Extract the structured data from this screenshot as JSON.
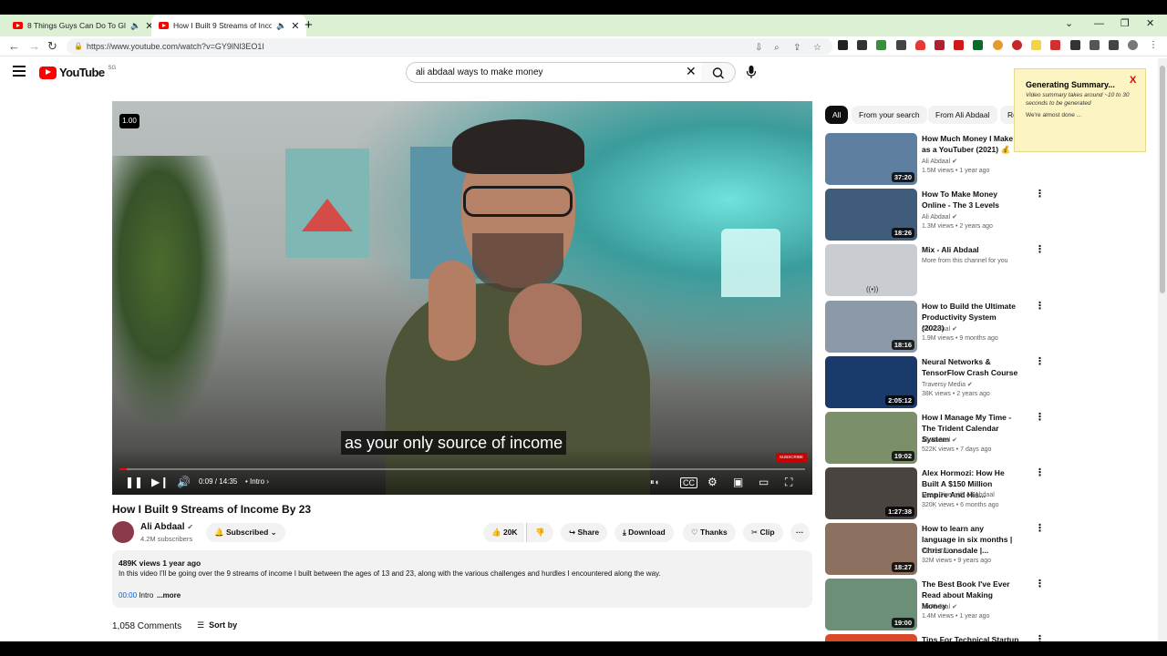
{
  "browser": {
    "tabs": [
      {
        "title": "8 Things Guys Can Do To Gl"
      },
      {
        "title": "How I Built 9 Streams of Inco"
      }
    ],
    "url": "https://www.youtube.com/watch?v=GY9lNl3EO1I"
  },
  "header": {
    "logo_text": "YouTube",
    "country_code": "SG",
    "search_value": "ali abdaal ways to make money"
  },
  "player": {
    "speed": "1.00",
    "caption": "as your only source of income",
    "time": "0:09 / 14:35",
    "chapter": "Intro",
    "progress_fraction": 0.011
  },
  "video": {
    "title": "How I Built 9 Streams of Income By 23",
    "channel": "Ali Abdaal",
    "subscribers": "4.2M subscribers",
    "subscribed_label": "Subscribed",
    "likes": "20K",
    "share_label": "Share",
    "download_label": "Download",
    "thanks_label": "Thanks",
    "clip_label": "Clip",
    "views_date": "489K views  1 year ago",
    "description": "In this video I'll be going over the 9 streams of income I built between the ages of 13 and 23, along with the various challenges and hurdles I encountered along the way.",
    "chapter_time": "00:00",
    "chapter_name": "Intro",
    "more_label": "...more",
    "comments": "1,058 Comments",
    "sort_label": "Sort by"
  },
  "sidebar": {
    "chips": [
      "All",
      "From your search",
      "From Ali Abdaal",
      "Re"
    ],
    "recommendations": [
      {
        "title": "How Much Money I Make as a YouTuber (2021) 💰",
        "channel": "Ali Abdaal",
        "meta": "1.5M views • 1 year ago",
        "duration": "37:20",
        "thumb_color": "#5e7fa0"
      },
      {
        "title": "How To Make Money Online - The 3 Levels",
        "channel": "Ali Abdaal",
        "meta": "1.3M views • 2 years ago",
        "duration": "18:26",
        "thumb_color": "#3f5c7a"
      },
      {
        "title": "Mix - Ali Abdaal",
        "channel": "More from this channel for you",
        "meta": "",
        "duration": "",
        "thumb_color": "#c9cdd1"
      },
      {
        "title": "How to Build the Ultimate Productivity System (2023)",
        "channel": "Ali Abdaal",
        "meta": "1.9M views • 9 months ago",
        "duration": "18:16",
        "thumb_color": "#8b9aa6"
      },
      {
        "title": "Neural Networks & TensorFlow Crash Course",
        "channel": "Traversy Media",
        "meta": "38K views • 2 years ago",
        "duration": "2:05:12",
        "thumb_color": "#1a3a6b"
      },
      {
        "title": "How I Manage My Time - The Trident Calendar System",
        "channel": "Ali Abdaal",
        "meta": "522K views • 7 days ago",
        "duration": "19:02",
        "thumb_color": "#7a8f6a"
      },
      {
        "title": "Alex Hormozi: How He Built A $150 Million Empire And His...",
        "channel": "Deep Dive with Ali Abdaal",
        "meta": "320K views • 6 months ago",
        "duration": "1:27:38",
        "thumb_color": "#4a4440"
      },
      {
        "title": "How to learn any language in six months | Chris Lonsdale |...",
        "channel": "TEDx Talks",
        "meta": "32M views • 9 years ago",
        "duration": "18:27",
        "thumb_color": "#8c7060"
      },
      {
        "title": "The Best Book I've Ever Read about Making Money",
        "channel": "Ali Abdaal",
        "meta": "1.4M views • 1 year ago",
        "duration": "19:00",
        "thumb_color": "#6c8f78"
      }
    ],
    "partial_title": "Tips For Technical Startup"
  },
  "popup": {
    "title": "Generating Summary...",
    "body": "Video summary takes around ~10 to 30 seconds to be generated",
    "status": "We're almost done ...",
    "close": "X"
  },
  "colors": {
    "accent": "#ff0000",
    "link": "#065fd4"
  }
}
